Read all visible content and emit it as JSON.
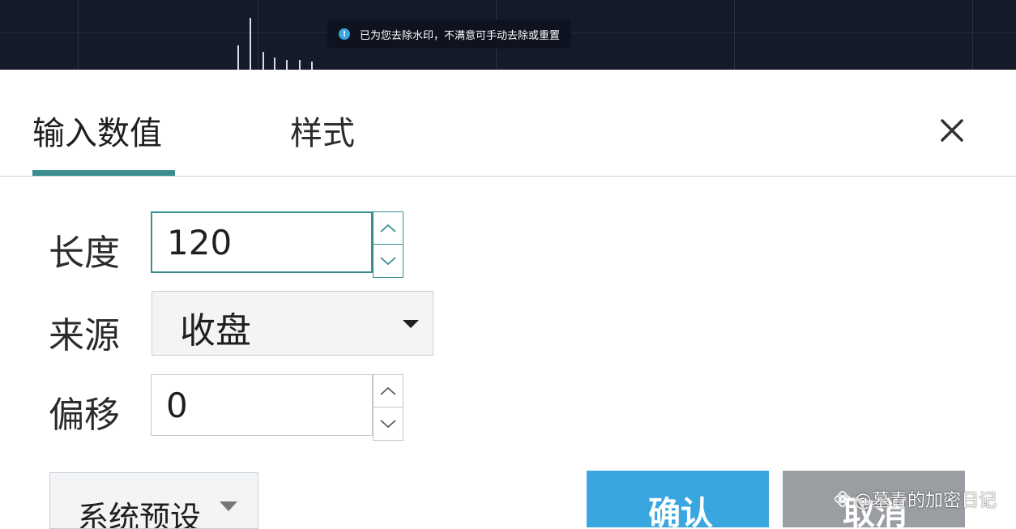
{
  "toast": {
    "icon": "info-icon",
    "message": "已为您去除水印，不满意可手动去除或重置"
  },
  "tabs": [
    {
      "label": "输入数值",
      "active": true
    },
    {
      "label": "样式",
      "active": false
    }
  ],
  "form": {
    "length": {
      "label": "长度",
      "value": "120"
    },
    "source": {
      "label": "来源",
      "value": "收盘"
    },
    "offset": {
      "label": "偏移",
      "value": "0"
    }
  },
  "footer": {
    "preset_label": "系统预设",
    "confirm_label": "确认",
    "cancel_label": "取消"
  },
  "watermark": {
    "text": "@墓青的加密日记"
  },
  "colors": {
    "accent": "#3a8e91",
    "confirm": "#3aa6e0",
    "cancel": "#9a9ea3",
    "chart_bg": "#151a2a"
  }
}
